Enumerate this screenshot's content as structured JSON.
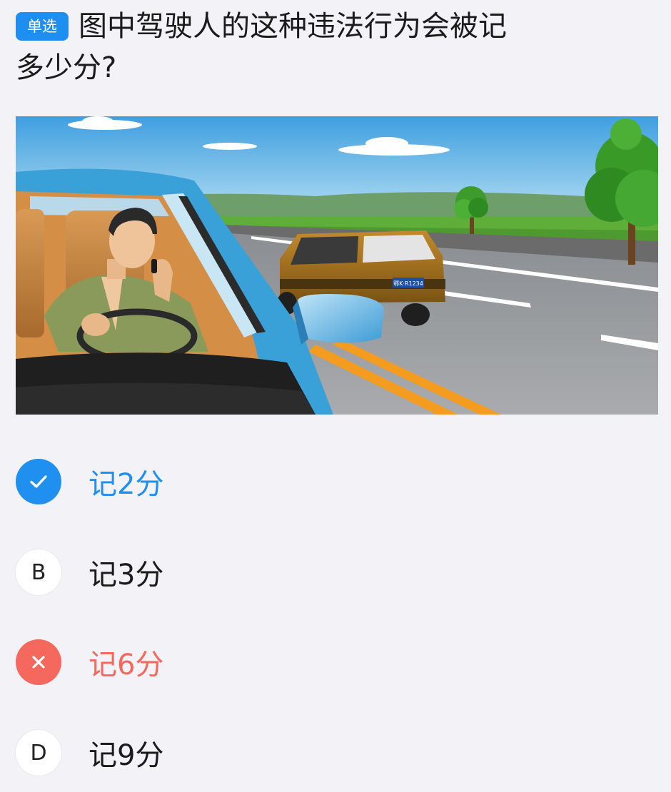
{
  "question": {
    "type_badge": "单选",
    "text_line1": "图中驾驶人的这种违法行为会被记",
    "text_line2": "多少分?"
  },
  "scene": {
    "plate_text": "鄂K·R1234"
  },
  "options": [
    {
      "marker": "",
      "label": "记2分",
      "state": "correct",
      "icon": "check-icon"
    },
    {
      "marker": "B",
      "label": "记3分",
      "state": "normal",
      "icon": ""
    },
    {
      "marker": "",
      "label": "记6分",
      "state": "wrong",
      "icon": "close-icon"
    },
    {
      "marker": "D",
      "label": "记9分",
      "state": "normal",
      "icon": ""
    }
  ],
  "colors": {
    "badge": "#1f8ef1",
    "correct": "#1f90f0",
    "wrong": "#f5685d",
    "background": "#f3f2f7"
  }
}
